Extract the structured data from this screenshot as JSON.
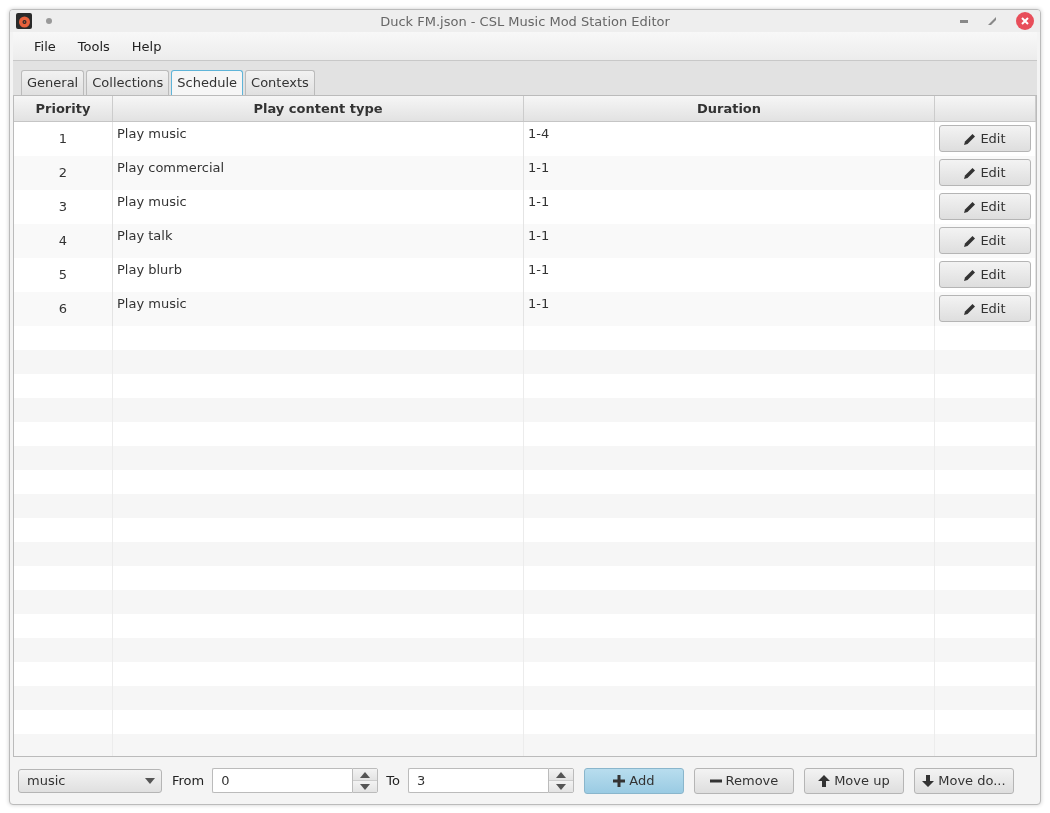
{
  "window": {
    "title": "Duck FM.json - CSL Music Mod Station Editor"
  },
  "menu": [
    "File",
    "Tools",
    "Help"
  ],
  "tabs": [
    {
      "label": "General",
      "selected": false
    },
    {
      "label": "Collections",
      "selected": false
    },
    {
      "label": "Schedule",
      "selected": true
    },
    {
      "label": "Contexts",
      "selected": false
    }
  ],
  "table": {
    "columns": [
      "Priority",
      "Play content type",
      "Duration"
    ],
    "rows": [
      {
        "priority": "1",
        "type": "Play music",
        "duration": "1-4",
        "action": "Edit"
      },
      {
        "priority": "2",
        "type": "Play commercial",
        "duration": "1-1",
        "action": "Edit"
      },
      {
        "priority": "3",
        "type": "Play music",
        "duration": "1-1",
        "action": "Edit"
      },
      {
        "priority": "4",
        "type": "Play talk",
        "duration": "1-1",
        "action": "Edit"
      },
      {
        "priority": "5",
        "type": "Play blurb",
        "duration": "1-1",
        "action": "Edit"
      },
      {
        "priority": "6",
        "type": "Play music",
        "duration": "1-1",
        "action": "Edit"
      }
    ]
  },
  "toolbar": {
    "content_type": "music",
    "from_label": "From",
    "from_value": "0",
    "to_label": "To",
    "to_value": "3",
    "buttons": [
      {
        "kind": "add",
        "label": "Add",
        "highlighted": true
      },
      {
        "kind": "remove",
        "label": "Remove",
        "highlighted": false
      },
      {
        "kind": "up",
        "label": "Move up",
        "highlighted": false
      },
      {
        "kind": "down",
        "label": "Move do...",
        "highlighted": false
      }
    ]
  }
}
